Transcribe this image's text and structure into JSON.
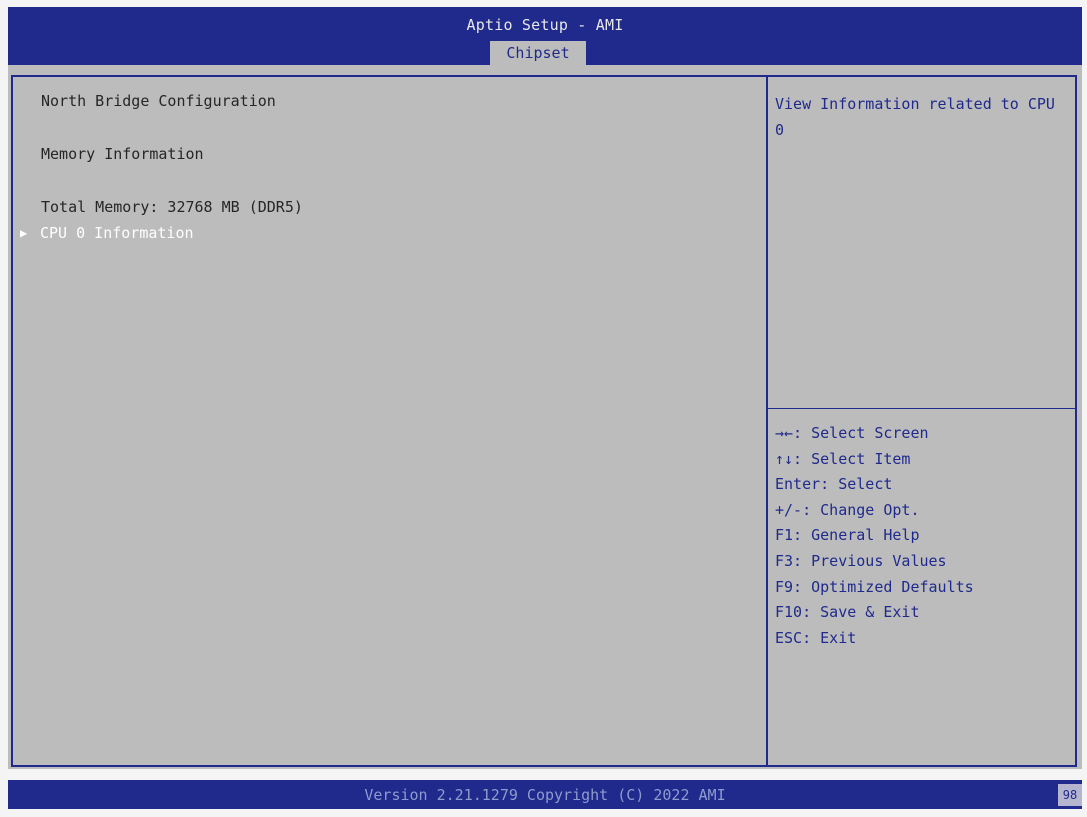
{
  "header": {
    "title": "Aptio Setup - AMI",
    "active_tab": "Chipset"
  },
  "main": {
    "lines": [
      "North Bridge Configuration",
      "Memory Information",
      "Total Memory: 32768 MB (DDR5)"
    ],
    "selected_item": "CPU 0 Information"
  },
  "help": {
    "text": "View Information related to CPU 0"
  },
  "keys": [
    "→←: Select Screen",
    "↑↓: Select Item",
    "Enter: Select",
    "+/-: Change Opt.",
    "F1: General Help",
    "F3: Previous Values",
    "F9: Optimized Defaults",
    "F10: Save & Exit",
    "ESC: Exit"
  ],
  "footer": {
    "version": "Version 2.21.1279 Copyright (C) 2022 AMI",
    "corner_code": "98"
  },
  "colors": {
    "bar_blue": "#1f2a8c",
    "panel_gray": "#bcbcbc",
    "selected_white": "#ffffff"
  }
}
